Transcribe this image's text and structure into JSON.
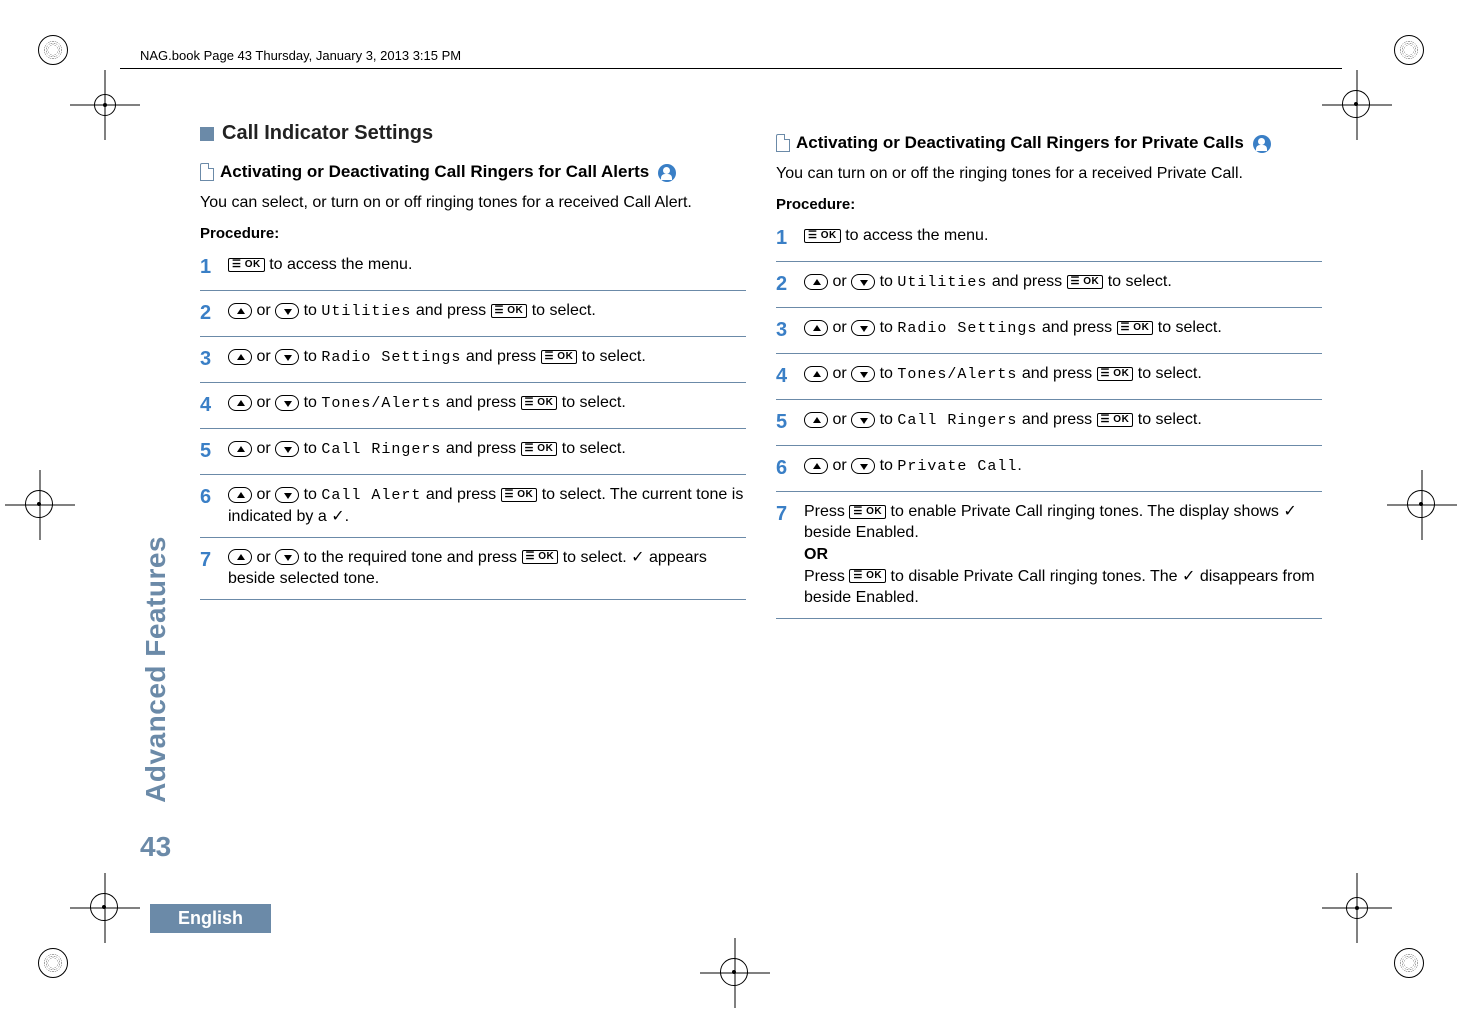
{
  "header": {
    "running_head": "NAG.book  Page 43  Thursday, January 3, 2013  3:15 PM"
  },
  "sidebar": {
    "section_label": "Advanced Features",
    "page_number": "43"
  },
  "footer": {
    "language": "English"
  },
  "glyphs": {
    "ok_btn": "☰ OK",
    "check": "✓"
  },
  "left": {
    "heading": "Call Indicator Settings",
    "sub_heading": "Activating or Deactivating Call Ringers for Call Alerts",
    "intro": "You can select, or turn on or off ringing tones for a received Call Alert.",
    "procedure_label": "Procedure:",
    "steps": [
      {
        "n": "1",
        "pre": "",
        "menu": "",
        "post": " to access the menu."
      },
      {
        "n": "2",
        "pre": " or ",
        "menu": "Utilities",
        "post": " and press ",
        "tail": " to select."
      },
      {
        "n": "3",
        "pre": " or ",
        "menu": "Radio Settings",
        "post": " and press ",
        "tail": " to select."
      },
      {
        "n": "4",
        "pre": " or ",
        "menu": "Tones/Alerts",
        "post": " and press ",
        "tail": " to select."
      },
      {
        "n": "5",
        "pre": " or ",
        "menu": "Call Ringers",
        "post": " and press ",
        "tail": " to select."
      },
      {
        "n": "6",
        "pre": " or ",
        "menu": "Call Alert",
        "post": " and press ",
        "tail": " to select. The current tone is indicated by a ",
        "tail2": "."
      },
      {
        "n": "7",
        "pre": " or ",
        "menu": "",
        "mid": " to the required tone and press ",
        "tail": " to select. ",
        "tail2": " appears beside selected tone."
      }
    ]
  },
  "right": {
    "sub_heading": "Activating or Deactivating Call Ringers for Private Calls",
    "intro": "You can turn on or off the ringing tones for a received Private Call.",
    "procedure_label": "Procedure:",
    "steps": [
      {
        "n": "1",
        "post": " to access the menu."
      },
      {
        "n": "2",
        "pre": " or ",
        "menu": "Utilities",
        "post": " and press ",
        "tail": " to select."
      },
      {
        "n": "3",
        "pre": " or ",
        "menu": "Radio Settings",
        "post": " and press ",
        "tail": " to select."
      },
      {
        "n": "4",
        "pre": " or ",
        "menu": "Tones/Alerts",
        "post": " and press ",
        "tail": " to select."
      },
      {
        "n": "5",
        "pre": " or ",
        "menu": "Call Ringers",
        "post": " and press ",
        "tail": " to select."
      },
      {
        "n": "6",
        "pre": " or ",
        "menu": "Private Call",
        "post": "."
      }
    ],
    "step7": {
      "n": "7",
      "line1a": "Press ",
      "line1b": " to enable Private Call ringing tones. The display shows ",
      "line1c": " beside Enabled.",
      "or": "OR",
      "line2a": "Press ",
      "line2b": " to disable Private Call ringing tones. The ",
      "line2c": " disappears from beside Enabled."
    }
  }
}
